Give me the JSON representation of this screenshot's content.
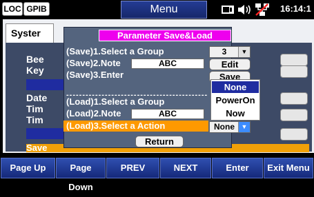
{
  "status_bar": {
    "loc_label": "LOC",
    "gpib_label": "GPIB",
    "menu_title": "Menu",
    "clock": "16:14:1"
  },
  "background_panel": {
    "tab_label": "Syster",
    "rows": [
      "Bee",
      "Key",
      "Date",
      "Tim",
      "Tim"
    ],
    "save_row_label": "Save"
  },
  "dialog": {
    "title": "Parameter Save&Load",
    "save_rows": [
      {
        "label": "(Save)1.Select a Group"
      },
      {
        "label": "(Save)2.Note"
      },
      {
        "label": "(Save)3.Enter"
      }
    ],
    "separator": "-----------------------------------------------",
    "load_rows": [
      {
        "label": "(Load)1.Select a Group"
      },
      {
        "label": "(Load)2.Note"
      },
      {
        "label": "(Load)3.Select a Action"
      }
    ],
    "save_group_value": "3",
    "save_note_value": "ABC",
    "load_note_value": "ABC",
    "edit_button": "Edit",
    "save_button": "Save",
    "action_value": "None",
    "return_button": "Return",
    "action_options": [
      "None",
      "PowerOn",
      "Now"
    ],
    "highlight_color": "#ff9900",
    "title_color": "#ee00ee"
  },
  "softkeys": [
    "Page Up",
    "Page Down",
    "PREV",
    "NEXT",
    "Enter",
    "Exit Menu"
  ]
}
